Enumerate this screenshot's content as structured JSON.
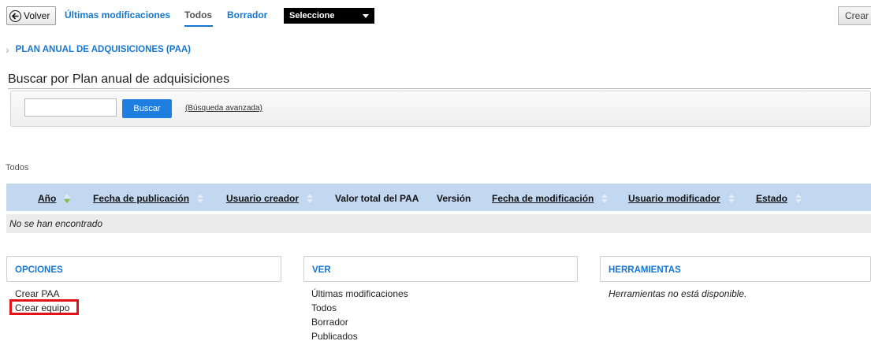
{
  "toolbar": {
    "back_label": "Volver",
    "tabs": [
      {
        "label": "Últimas modificaciones"
      },
      {
        "label": "Todos"
      },
      {
        "label": "Borrador"
      }
    ],
    "select_value": "Seleccione",
    "create_label": "Crear"
  },
  "breadcrumb": {
    "label": "PLAN ANUAL DE ADQUISICIONES (PAA)"
  },
  "search": {
    "title": "Buscar por Plan anual de adquisiciones",
    "input_value": "",
    "button_label": "Buscar",
    "advanced_label": "(Búsqueda avanzada)"
  },
  "table": {
    "filter_label": "Todos",
    "columns": [
      {
        "label": "Año"
      },
      {
        "label": "Fecha de publicación"
      },
      {
        "label": "Usuario creador"
      },
      {
        "label": "Valor total del PAA"
      },
      {
        "label": "Versión"
      },
      {
        "label": "Fecha de modificación"
      },
      {
        "label": "Usuario modificador"
      },
      {
        "label": "Estado"
      }
    ],
    "empty_message": "No se han encontrado"
  },
  "panels": {
    "opciones": {
      "title": "OPCIONES",
      "items": [
        {
          "label": "Crear PAA"
        },
        {
          "label": "Crear equipo"
        }
      ]
    },
    "ver": {
      "title": "VER",
      "items": [
        {
          "label": "Últimas modificaciones"
        },
        {
          "label": "Todos"
        },
        {
          "label": "Borrador"
        },
        {
          "label": "Publicados"
        }
      ]
    },
    "herramientas": {
      "title": "HERRAMIENTAS",
      "message": "Herramientas no está disponible."
    }
  },
  "colors": {
    "link": "#1577d2",
    "table_header": "#c2d7f0",
    "highlight": "#e0131b",
    "button": "#1f7fe0"
  }
}
